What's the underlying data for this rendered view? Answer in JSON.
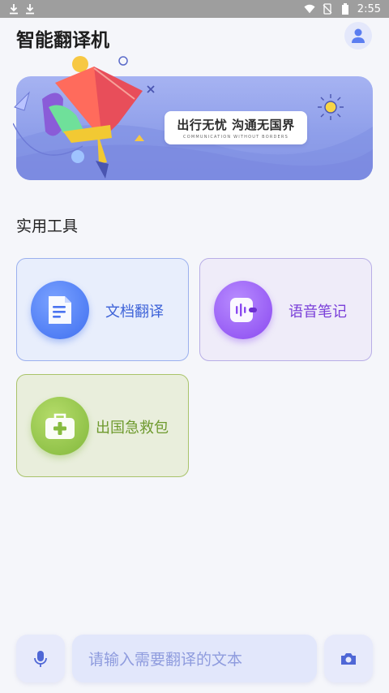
{
  "status_bar": {
    "time": "2:55",
    "left_icons": [
      "download-icon",
      "download-icon"
    ],
    "right_icons": [
      "wifi-icon",
      "no-sim-icon",
      "battery-icon"
    ]
  },
  "header": {
    "title": "智能翻译机",
    "profile_icon": "user-icon"
  },
  "banner": {
    "slogan": "出行无忧 沟通无国界",
    "subtitle": "COMMUNICATION WITHOUT BORDERS"
  },
  "tools": {
    "section_title": "实用工具",
    "items": [
      {
        "label": "文档翻译",
        "icon": "document-icon",
        "color": "#3d62d8"
      },
      {
        "label": "语音笔记",
        "icon": "voice-note-icon",
        "color": "#7a3fd9"
      },
      {
        "label": "出国急救包",
        "icon": "first-aid-kit-icon",
        "color": "#6e9a2e"
      }
    ]
  },
  "bottom_bar": {
    "mic_icon": "microphone-icon",
    "input_placeholder": "请输入需要翻译的文本",
    "camera_icon": "camera-icon"
  }
}
